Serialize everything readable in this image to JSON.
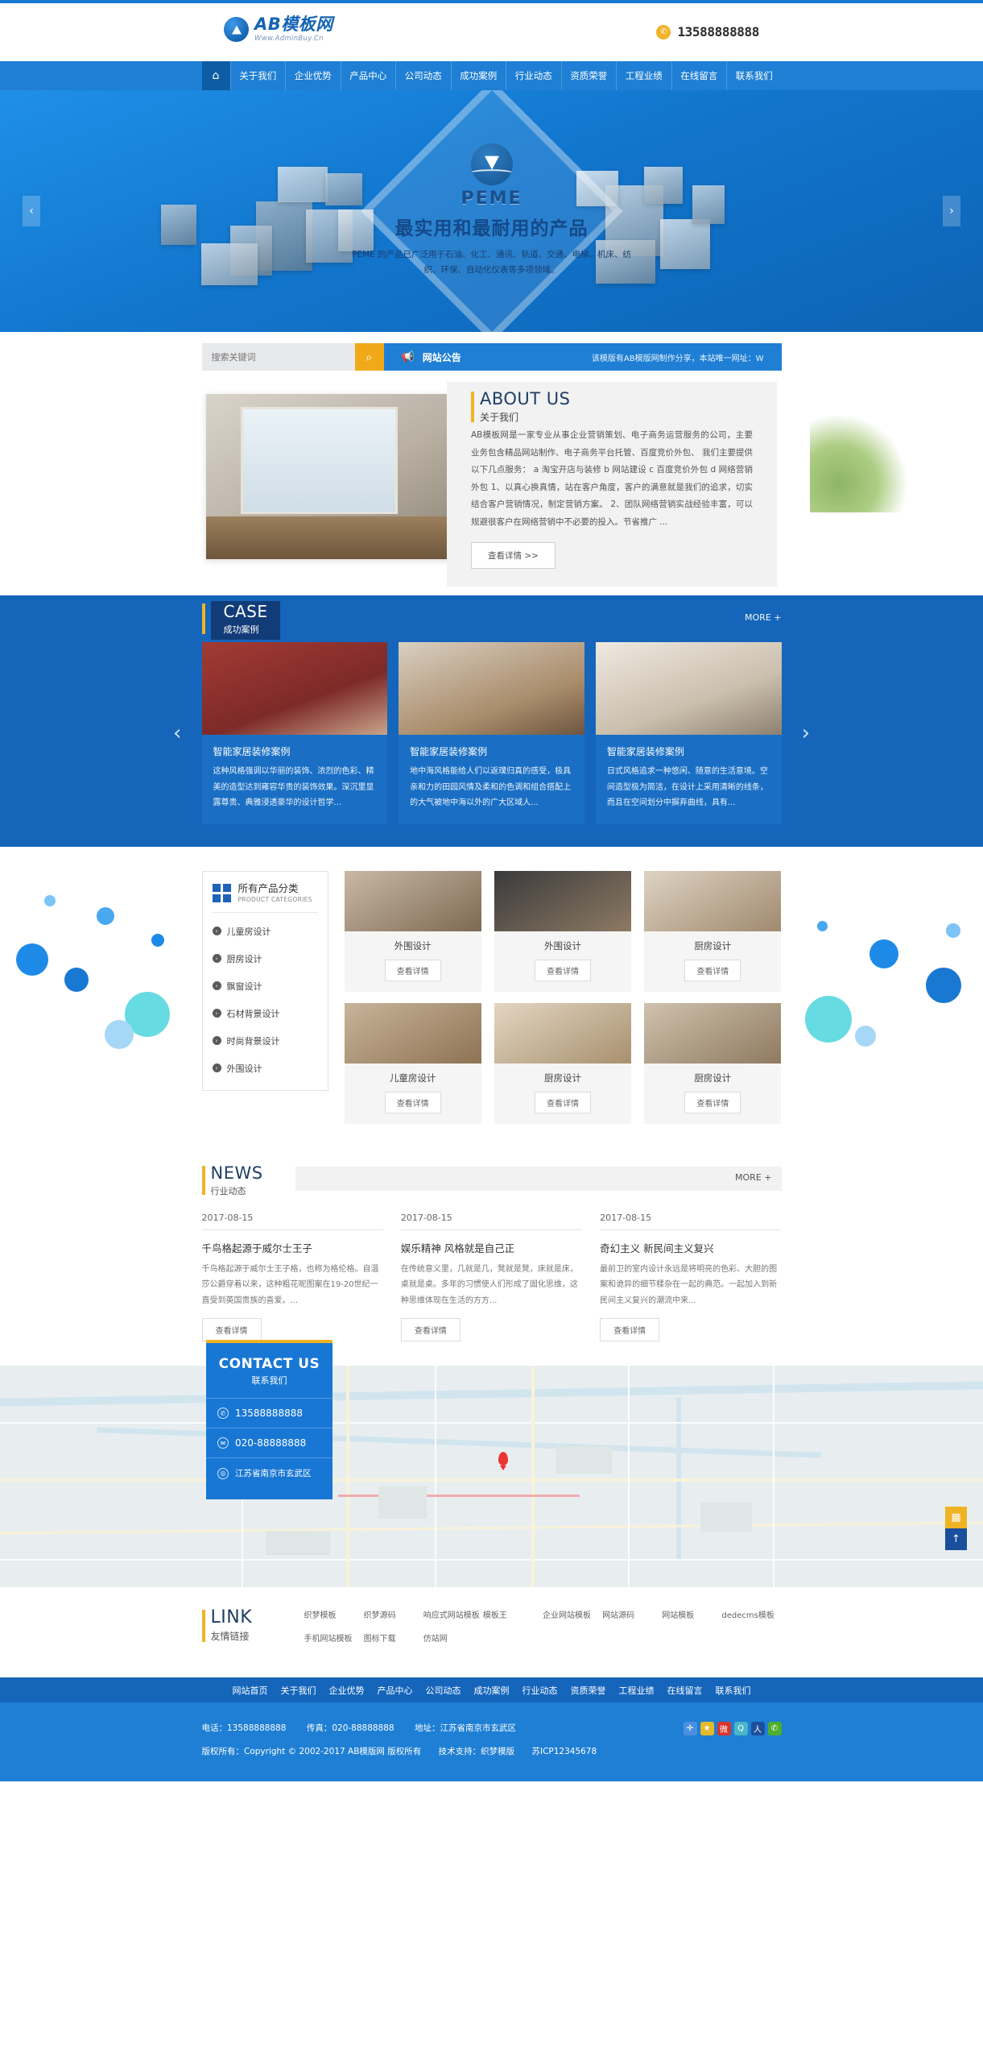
{
  "site": {
    "logo_title": "AB模板网",
    "logo_sub": "Www.AdminBuy.Cn",
    "phone": "13588888888"
  },
  "nav": {
    "home_icon": "home-icon",
    "items": [
      "关于我们",
      "企业优势",
      "产品中心",
      "公司动态",
      "成功案例",
      "行业动态",
      "资质荣誉",
      "工程业绩",
      "在线留言",
      "联系我们"
    ]
  },
  "banner": {
    "brand": "PEME",
    "headline": "最实用和最耐用的产品",
    "description": "PEME 的产品已广泛用于石油、化工、通讯、轨道、交通、电梯、机床、纺织、环保、自动化仪表等多项领域。",
    "prev": "‹",
    "next": "›"
  },
  "search": {
    "placeholder": "搜索关键词",
    "value": "",
    "button_icon": "search-icon",
    "notice_title": "网站公告",
    "notice_text": "该模版有AB模版网制作分享，本站唯一网址：W"
  },
  "about": {
    "title_en": "ABOUT US",
    "title_cn": "关于我们",
    "text": "AB模板网是一家专业从事企业营销策划、电子商务运营服务的公司，主要业务包含精品网站制作、电子商务平台托管、百度竞价外包、 我们主要提供以下几点服务： a 淘宝开店与装修 b 网站建设 c 百度竞价外包 d 网络营销外包 1、以真心换真情，站在客户角度，客户的满意就是我们的追求，切实结合客户营销情况，制定营销方案。 2、团队网络营销实战经验丰富，可以规避很客户在网络营销中不必要的投入。节省推广 ...",
    "button": "查看详情 >>"
  },
  "case": {
    "title_en": "CASE",
    "title_cn": "成功案例",
    "more": "MORE +",
    "prev": "‹",
    "next": "›",
    "items": [
      {
        "title": "智能家居装修案例",
        "desc": "这种风格强调以华丽的装饰、浓烈的色彩、精美的造型达到雍容华贵的装饰效果。深沉里显露尊贵、典雅浸透豪华的设计哲学..."
      },
      {
        "title": "智能家居装修案例",
        "desc": "地中海风格能给人们以返璞归真的感受，极具亲和力的田园风情及柔和的色调和组合搭配上的大气被地中海以外的广大区域人..."
      },
      {
        "title": "智能家居装修案例",
        "desc": "日式风格追求一种悠闲、随意的生活意境。空间造型极为简洁，在设计上采用清晰的线条，而且在空间划分中摒弃曲线，具有..."
      }
    ]
  },
  "products": {
    "cat_title_cn": "所有产品分类",
    "cat_title_en": "PRODUCT CATEGORIES",
    "categories": [
      "儿童房设计",
      "厨房设计",
      "飘窗设计",
      "石材背景设计",
      "时尚背景设计",
      "外围设计"
    ],
    "detail_button": "查看详情",
    "items": [
      {
        "name": "外围设计"
      },
      {
        "name": "外围设计"
      },
      {
        "name": "厨房设计"
      },
      {
        "name": "儿童房设计"
      },
      {
        "name": "厨房设计"
      },
      {
        "name": "厨房设计"
      }
    ]
  },
  "news": {
    "title_en": "NEWS",
    "title_cn": "行业动态",
    "more": "MORE +",
    "detail_button": "查看详情",
    "items": [
      {
        "date": "2017-08-15",
        "title": "千鸟格起源于威尔士王子",
        "desc": "千鸟格起源于威尔士王子格，也称为格伦格。自温莎公爵穿着以来，这种粗花呢图案在19-20世纪一直受到英国贵族的喜爱。..."
      },
      {
        "date": "2017-08-15",
        "title": "娱乐精神 风格就是自己正",
        "desc": "在传统意义里，几就是几，凳就是凳，床就是床，桌就是桌。多年的习惯使人们形成了固化思维，这种思维体现在生活的方方..."
      },
      {
        "date": "2017-08-15",
        "title": "奇幻主义 新民间主义复兴",
        "desc": "最前卫的室内设计永远是将明亮的色彩、大胆的图案和诡异的细节糅杂在一起的典范。一起加入到新民间主义复兴的潮流中来..."
      }
    ]
  },
  "contact": {
    "title_en": "CONTACT US",
    "title_cn": "联系我们",
    "phone": "13588888888",
    "fax": "020-88888888",
    "address": "江苏省南京市玄武区",
    "map_qr_icon": "qr-code-icon",
    "map_up_icon": "arrow-up-icon"
  },
  "links": {
    "title_en": "LINK",
    "title_cn": "友情链接",
    "items": [
      "织梦模板",
      "织梦源码",
      "响应式网站模板",
      "模板王",
      "企业网站模板",
      "网站源码",
      "网站模板",
      "dedecms模板",
      "手机网站模板",
      "图标下载",
      "仿站网"
    ]
  },
  "footer": {
    "nav": [
      "网站首页",
      "关于我们",
      "企业优势",
      "产品中心",
      "公司动态",
      "成功案例",
      "行业动态",
      "资质荣誉",
      "工程业绩",
      "在线留言",
      "联系我们"
    ],
    "tel": "电话：13588888888",
    "fax": "传真：020-88888888",
    "address": "地址：江苏省南京市玄武区",
    "copyright": "版权所有：Copyright © 2002-2017 AB模版网 版权所有",
    "support": "技术支持：织梦模版",
    "icp": "苏ICP12345678",
    "social": [
      "share-icon",
      "favorite-icon",
      "weibo-icon",
      "qzone-icon",
      "renren-icon",
      "wechat-icon"
    ]
  },
  "colors": {
    "brand_blue": "#1e7fd4",
    "deep_blue": "#1565bb",
    "accent_yellow": "#f0b323",
    "nav_active": "#0e5da4"
  }
}
